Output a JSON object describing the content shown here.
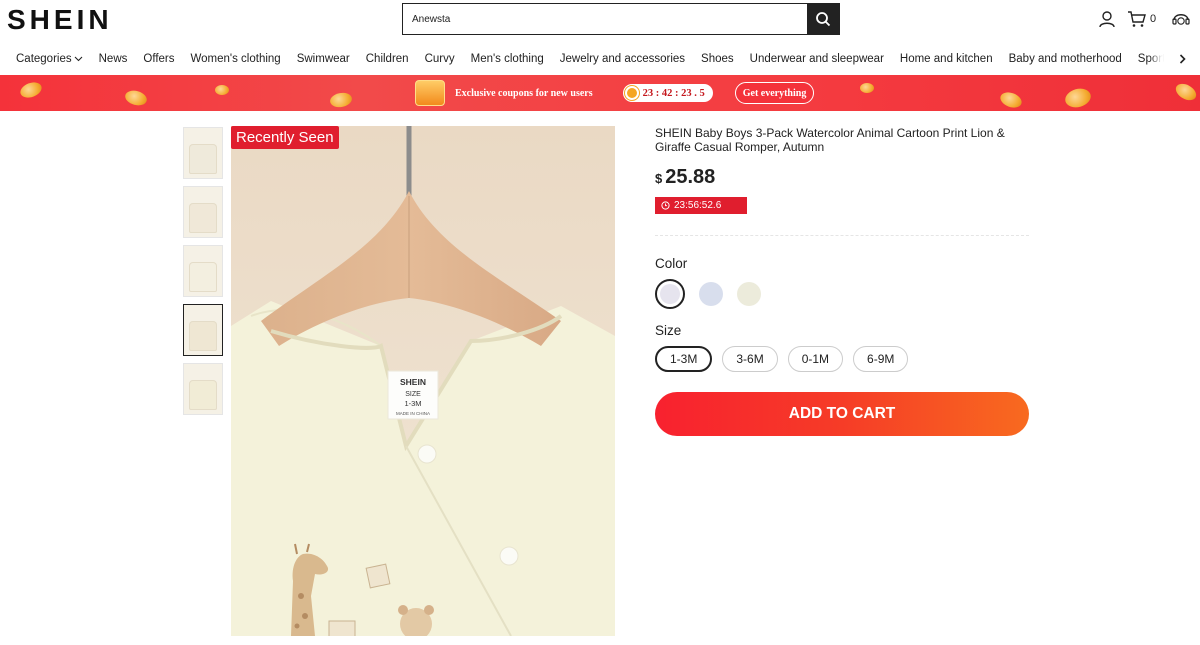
{
  "header": {
    "logo": "SHEIN",
    "search_value": "Anewsta",
    "cart_count": "0"
  },
  "nav": {
    "items": [
      "Categories",
      "News",
      "Offers",
      "Women's clothing",
      "Swimwear",
      "Children",
      "Curvy",
      "Men's clothing",
      "Jewelry and accessories",
      "Shoes",
      "Underwear and sleepwear",
      "Home and kitchen",
      "Baby and motherhood",
      "Sports and outd"
    ]
  },
  "banner": {
    "text": "Exclusive coupons for new users",
    "timer": "23 : 42 : 23 . 5",
    "button": "Get everything"
  },
  "gallery": {
    "tag": "Recently Seen",
    "thumbnail_count": 5,
    "active_thumbnail": 4,
    "label_brand": "SHEIN",
    "label_size_title": "SIZE",
    "label_size": "1-3M",
    "label_origin": "MADE IN CHINA"
  },
  "product": {
    "title": "SHEIN Baby Boys 3-Pack Watercolor Animal Cartoon Print Lion & Giraffe Casual Romper, Autumn",
    "currency": "$",
    "price": "25.88",
    "countdown": "23:56:52.6",
    "color_label": "Color",
    "colors": [
      "#e6e4ee",
      "#d8deed",
      "#ecebdb"
    ],
    "size_label": "Size",
    "sizes": [
      "1-3M",
      "3-6M",
      "0-1M",
      "6-9M"
    ],
    "selected_size": "1-3M",
    "add_to_cart": "ADD TO CART"
  }
}
